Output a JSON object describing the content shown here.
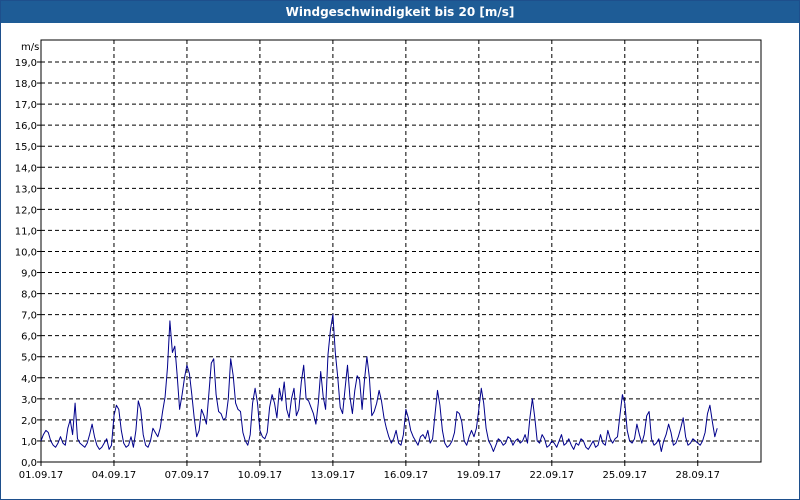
{
  "window": {
    "title": "Windgeschwindigkeit bis 20 [m/s]"
  },
  "chart_data": {
    "type": "line",
    "title": "Windgeschwindigkeit bis 20 [m/s]",
    "ylabel": "m/s",
    "xlabel": "",
    "ylim": [
      0,
      19.0
    ],
    "yticks": [
      "0,0",
      "1,0",
      "2,0",
      "3,0",
      "4,0",
      "5,0",
      "6,0",
      "7,0",
      "8,0",
      "9,0",
      "10,0",
      "11,0",
      "12,0",
      "13,0",
      "14,0",
      "15,0",
      "16,0",
      "17,0",
      "18,0",
      "19,0"
    ],
    "x_tick_labels": [
      "01.09.17",
      "04.09.17",
      "07.09.17",
      "10.09.17",
      "13.09.17",
      "16.09.17",
      "19.09.17",
      "22.09.17",
      "25.09.17",
      "28.09.17"
    ],
    "x_tick_days": [
      0,
      3,
      6,
      9,
      12,
      15,
      18,
      21,
      24,
      27
    ],
    "xlim_days": [
      0,
      29.6
    ],
    "grid": true,
    "line_color": "#00008b",
    "series": [
      {
        "x_days": [
          0,
          0.1,
          0.2,
          0.3,
          0.4,
          0.5,
          0.6,
          0.7,
          0.8,
          0.9,
          1.0,
          1.1,
          1.2,
          1.3,
          1.4,
          1.5,
          1.6,
          1.7,
          1.8,
          1.9,
          2.0,
          2.1,
          2.2,
          2.3,
          2.4,
          2.5,
          2.6,
          2.7,
          2.8,
          2.9,
          3.0,
          3.1,
          3.2,
          3.3,
          3.4,
          3.5,
          3.6,
          3.7,
          3.8,
          3.9,
          4.0,
          4.1,
          4.2,
          4.3,
          4.4,
          4.5,
          4.6,
          4.7,
          4.8,
          4.9,
          5.0,
          5.1,
          5.2,
          5.3,
          5.4,
          5.5,
          5.6,
          5.7,
          5.8,
          5.9,
          6.0,
          6.1,
          6.2,
          6.3,
          6.4,
          6.5,
          6.6,
          6.7,
          6.8,
          6.9,
          7.0,
          7.1,
          7.2,
          7.3,
          7.4,
          7.5,
          7.6,
          7.7,
          7.8,
          7.9,
          8.0,
          8.1,
          8.2,
          8.3,
          8.4,
          8.5,
          8.6,
          8.7,
          8.8,
          8.9,
          9.0,
          9.1,
          9.2,
          9.3,
          9.4,
          9.5,
          9.6,
          9.7,
          9.8,
          9.9,
          10.0,
          10.1,
          10.2,
          10.3,
          10.4,
          10.5,
          10.6,
          10.7,
          10.8,
          10.9,
          11.0,
          11.1,
          11.2,
          11.3,
          11.4,
          11.5,
          11.6,
          11.7,
          11.8,
          11.9,
          12.0,
          12.1,
          12.2,
          12.3,
          12.4,
          12.5,
          12.6,
          12.7,
          12.8,
          12.9,
          13.0,
          13.1,
          13.2,
          13.3,
          13.4,
          13.5,
          13.6,
          13.7,
          13.8,
          13.9,
          14.0,
          14.1,
          14.2,
          14.3,
          14.4,
          14.5,
          14.6,
          14.7,
          14.8,
          14.9,
          15.0,
          15.1,
          15.2,
          15.3,
          15.4,
          15.5,
          15.6,
          15.7,
          15.8,
          15.9,
          16.0,
          16.1,
          16.2,
          16.3,
          16.4,
          16.5,
          16.6,
          16.7,
          16.8,
          16.9,
          17.0,
          17.1,
          17.2,
          17.3,
          17.4,
          17.5,
          17.6,
          17.7,
          17.8,
          17.9,
          18.0,
          18.1,
          18.2,
          18.3,
          18.4,
          18.5,
          18.6,
          18.7,
          18.8,
          18.9,
          19.0,
          19.1,
          19.2,
          19.3,
          19.4,
          19.5,
          19.6,
          19.7,
          19.8,
          19.9,
          20.0,
          20.1,
          20.2,
          20.3,
          20.4,
          20.5,
          20.6,
          20.7,
          20.8,
          20.9,
          21.0,
          21.1,
          21.2,
          21.3,
          21.4,
          21.5,
          21.6,
          21.7,
          21.8,
          21.9,
          22.0,
          22.1,
          22.2,
          22.3,
          22.4,
          22.5,
          22.6,
          22.7,
          22.8,
          22.9,
          23.0,
          23.1,
          23.2,
          23.3,
          23.4,
          23.5,
          23.6,
          23.7,
          23.8,
          23.9,
          24.0,
          24.1,
          24.2,
          24.3,
          24.4,
          24.5,
          24.6,
          24.7,
          24.8,
          24.9,
          25.0,
          25.1,
          25.2,
          25.3,
          25.4,
          25.5,
          25.6,
          25.7,
          25.8,
          25.9,
          26.0,
          26.1,
          26.2,
          26.3,
          26.4,
          26.5,
          26.6,
          26.7,
          26.8,
          26.9,
          27.0,
          27.1,
          27.2,
          27.3,
          27.4,
          27.5,
          27.6,
          27.7,
          27.8,
          27.9,
          28.0,
          28.1,
          28.2,
          28.3,
          28.4,
          28.5,
          28.6,
          28.7,
          28.8,
          28.9,
          29.0,
          29.1,
          29.2,
          29.3,
          29.4,
          29.5,
          29.6
        ],
        "values": [
          1.0,
          1.3,
          1.5,
          1.4,
          1.0,
          0.8,
          0.7,
          0.9,
          1.2,
          0.9,
          0.8,
          1.6,
          2.0,
          1.3,
          2.8,
          1.1,
          0.9,
          0.8,
          0.7,
          0.9,
          1.3,
          1.8,
          1.2,
          0.8,
          0.6,
          0.7,
          0.9,
          1.1,
          0.6,
          0.8,
          2.2,
          2.7,
          2.5,
          1.5,
          0.9,
          0.7,
          0.8,
          1.2,
          0.7,
          1.5,
          2.9,
          2.5,
          1.3,
          0.8,
          0.7,
          1.0,
          1.6,
          1.4,
          1.2,
          1.6,
          2.4,
          3.1,
          4.5,
          6.7,
          5.2,
          5.5,
          4.1,
          2.5,
          3.2,
          4.0,
          4.6,
          4.2,
          3.2,
          2.1,
          1.2,
          1.5,
          2.5,
          2.2,
          1.8,
          3.2,
          4.7,
          4.9,
          3.2,
          2.4,
          2.3,
          2.0,
          2.1,
          3.0,
          4.9,
          4.1,
          2.8,
          2.5,
          2.4,
          1.4,
          1.0,
          0.8,
          1.3,
          2.8,
          3.5,
          2.8,
          1.5,
          1.2,
          1.1,
          1.4,
          2.6,
          3.2,
          2.8,
          2.1,
          3.5,
          2.9,
          3.8,
          2.5,
          2.1,
          3.0,
          3.5,
          2.2,
          2.5,
          3.8,
          4.6,
          3.0,
          2.9,
          2.6,
          2.3,
          1.8,
          2.8,
          4.3,
          3.1,
          2.5,
          5.1,
          6.3,
          7.0,
          5.2,
          4.0,
          2.6,
          2.3,
          3.5,
          4.6,
          3.1,
          2.3,
          3.4,
          4.1,
          3.9,
          2.5,
          3.9,
          5.0,
          4.0,
          2.2,
          2.4,
          2.8,
          3.4,
          2.9,
          2.1,
          1.6,
          1.2,
          0.9,
          1.1,
          1.5,
          0.9,
          0.8,
          1.3,
          2.5,
          2.1,
          1.5,
          1.2,
          1.0,
          0.8,
          1.2,
          1.3,
          1.1,
          1.5,
          0.9,
          1.1,
          2.3,
          3.4,
          2.7,
          1.5,
          0.9,
          0.7,
          0.8,
          1.0,
          1.4,
          2.4,
          2.3,
          1.9,
          1.0,
          0.8,
          1.2,
          1.5,
          1.2,
          1.6,
          2.5,
          3.5,
          2.8,
          1.6,
          1.0,
          0.8,
          0.5,
          0.8,
          1.1,
          1.0,
          0.8,
          0.9,
          1.2,
          1.1,
          0.8,
          1.0,
          1.1,
          0.9,
          1.0,
          1.3,
          0.9,
          2.1,
          3.0,
          2.1,
          1.0,
          0.9,
          1.3,
          1.1,
          0.7,
          0.8,
          1.0,
          0.9,
          0.7,
          1.0,
          1.3,
          0.8,
          0.9,
          1.1,
          0.8,
          0.6,
          0.9,
          0.8,
          1.1,
          1.0,
          0.7,
          0.6,
          0.8,
          1.0,
          0.7,
          0.8,
          1.3,
          0.9,
          0.8,
          1.5,
          1.1,
          0.9,
          1.1,
          1.2,
          2.2,
          3.2,
          2.8,
          1.5,
          1.0,
          0.9,
          1.1,
          1.8,
          1.3,
          0.9,
          1.3,
          2.2,
          2.4,
          1.1,
          0.8,
          0.9,
          1.1,
          0.5,
          1.0,
          1.3,
          1.8,
          1.4,
          0.8,
          0.9,
          1.2,
          1.6,
          2.1,
          1.2,
          0.8,
          0.9,
          1.1,
          1.0,
          0.9,
          0.8,
          1.0,
          1.4,
          2.3,
          2.7,
          1.9,
          1.2,
          1.6
        ]
      }
    ]
  }
}
